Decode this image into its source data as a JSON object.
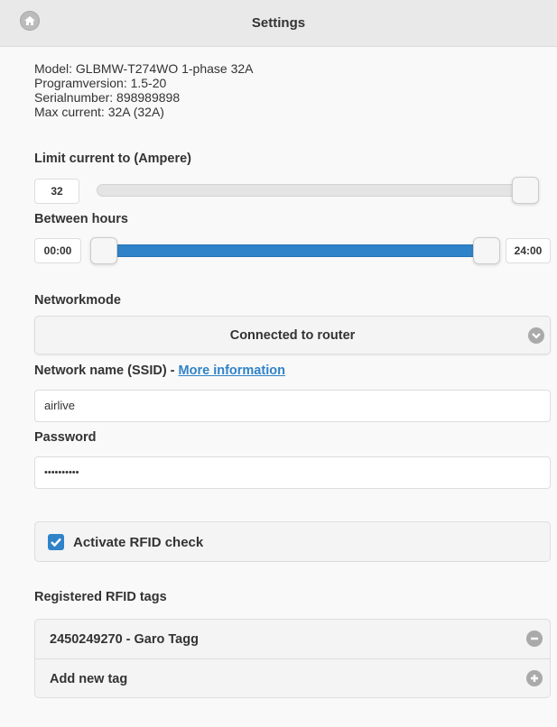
{
  "header": {
    "title": "Settings",
    "home_icon": "home-icon"
  },
  "device_info": {
    "model": "Model: GLBMW-T274WO 1-phase 32A",
    "program_version": "Programversion: 1.5-20",
    "serial_number": "Serialnumber: 898989898",
    "max_current": "Max current: 32A (32A)"
  },
  "limit_current": {
    "label": "Limit current to (Ampere)",
    "value": "32",
    "slider_max": 32,
    "slider_value": 32
  },
  "between_hours": {
    "label": "Between hours",
    "start": "00:00",
    "end": "24:00",
    "range_start_fraction": 0.0,
    "range_end_fraction": 1.0
  },
  "networkmode": {
    "label": "Networkmode",
    "selected": "Connected to router",
    "dropdown_icon": "chevron-down-icon"
  },
  "network_name": {
    "label": "Network name (SSID) - ",
    "link_text": "More information",
    "value": "airlive"
  },
  "password": {
    "label": "Password",
    "value": "••••••••••"
  },
  "rfid": {
    "label": "Activate RFID check",
    "checked": true
  },
  "registered_tags": {
    "label": "Registered RFID tags",
    "items": [
      {
        "label": "2450249270 - Garo Tagg",
        "icon": "minus-icon"
      },
      {
        "label": "Add new tag",
        "icon": "plus-icon"
      }
    ]
  },
  "colors": {
    "accent": "#2f83c8",
    "header_bg": "#e9e9e9",
    "icon_gray": "#aaaaaa"
  }
}
